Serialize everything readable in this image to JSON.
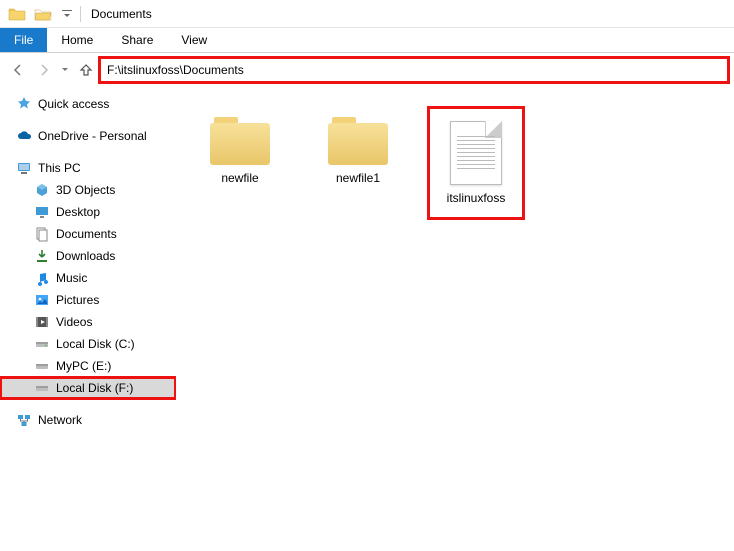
{
  "titlebar": {
    "title": "Documents"
  },
  "ribbon": {
    "file": "File",
    "home": "Home",
    "share": "Share",
    "view": "View"
  },
  "address": {
    "path": "F:\\itslinuxfoss\\Documents"
  },
  "navpane": {
    "quick_access": "Quick access",
    "onedrive": "OneDrive - Personal",
    "this_pc": "This PC",
    "children": {
      "objects3d": "3D Objects",
      "desktop": "Desktop",
      "documents": "Documents",
      "downloads": "Downloads",
      "music": "Music",
      "pictures": "Pictures",
      "videos": "Videos",
      "drive_c": "Local Disk (C:)",
      "drive_e": "MyPC (E:)",
      "drive_f": "Local Disk (F:)"
    },
    "network": "Network"
  },
  "items": [
    {
      "name": "newfile",
      "type": "folder"
    },
    {
      "name": "newfile1",
      "type": "folder"
    },
    {
      "name": "itslinuxfoss",
      "type": "textfile"
    }
  ]
}
